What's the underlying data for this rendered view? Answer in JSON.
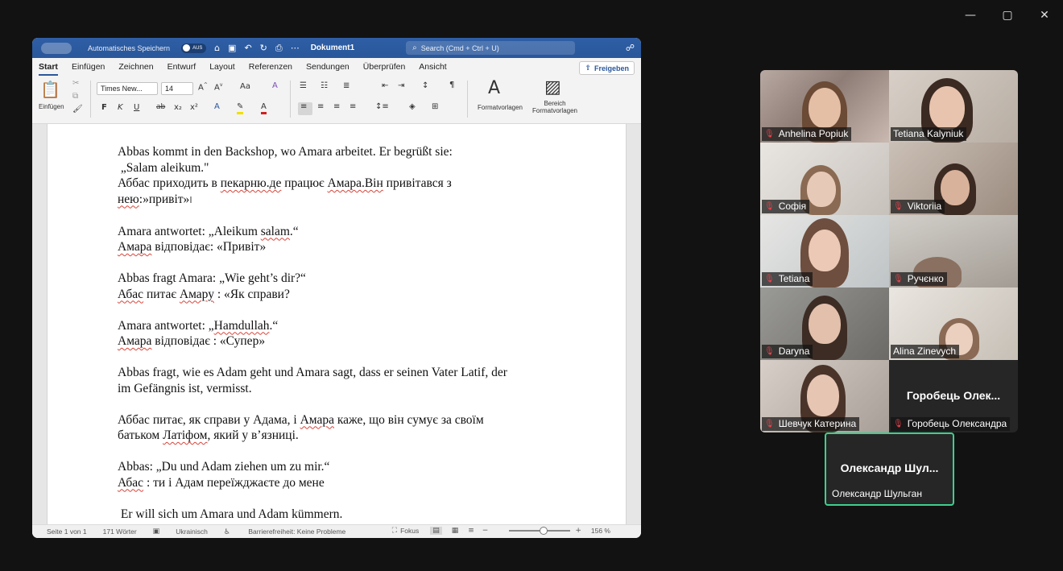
{
  "window_controls": [
    "—",
    "▢",
    "✕"
  ],
  "word": {
    "autosave_label": "Automatisches Speichern",
    "autosave_state": "AUS",
    "doc_name": "Dokument1",
    "search_placeholder": "Search (Cmd + Ctrl + U)",
    "tabs": [
      "Start",
      "Einfügen",
      "Zeichnen",
      "Entwurf",
      "Layout",
      "Referenzen",
      "Sendungen",
      "Überprüfen",
      "Ansicht"
    ],
    "share_label": "Freigeben",
    "ribbon": {
      "paste_label": "Einfügen",
      "font_name": "Times New...",
      "font_size": "14",
      "styles_label": "Formatvorlagen",
      "styles_pane_label_1": "Bereich",
      "styles_pane_label_2": "Formatvorlagen",
      "bold": "F",
      "italic": "K",
      "underline": "U",
      "strike": "ab",
      "change_case": "Aa"
    },
    "paragraphs": [
      [
        {
          "t": "Abbas kommt in den Backshop, wo Amara arbeitet. Er begrüßt sie:"
        }
      ],
      [
        {
          "t": " „Salam aleikum.\""
        }
      ],
      [
        {
          "t": "Аббас приходить в "
        },
        {
          "t": "пекарню.де",
          "sq": true
        },
        {
          "t": " працює "
        },
        {
          "t": "Амара.Він",
          "sq": true
        },
        {
          "t": " привітався з"
        }
      ],
      [
        {
          "t": "нею",
          "sq": true
        },
        {
          "t": ":»привіт»"
        },
        {
          "t": "I",
          "cursor": true
        }
      ],
      [],
      [
        {
          "t": "Amara antwortet: „Aleikum "
        },
        {
          "t": "salam",
          "sq": true
        },
        {
          "t": ".“"
        }
      ],
      [
        {
          "t": "Амара",
          "sq": true
        },
        {
          "t": " відповідає: «Привіт»"
        }
      ],
      [],
      [
        {
          "t": "Abbas fragt Amara: „Wie geht’s dir?“"
        }
      ],
      [
        {
          "t": "Абас",
          "sq": true
        },
        {
          "t": " питає "
        },
        {
          "t": "Амару",
          "sq": true
        },
        {
          "t": " : «Як справи?"
        }
      ],
      [],
      [
        {
          "t": "Amara antwortet: „"
        },
        {
          "t": "Hamdullah",
          "sq": true
        },
        {
          "t": ".“"
        }
      ],
      [
        {
          "t": "Амара",
          "sq": true
        },
        {
          "t": " відповідає : «Супер»"
        }
      ],
      [],
      [
        {
          "t": "Abbas fragt, wie es Adam geht und Amara sagt, dass er seinen Vater Latif, der"
        }
      ],
      [
        {
          "t": "im Gefängnis ist, vermisst."
        }
      ],
      [],
      [
        {
          "t": "Аббас питає, як справи у Адама, і "
        },
        {
          "t": "Амара",
          "sq": true
        },
        {
          "t": " каже, що він сумує за своїм"
        }
      ],
      [
        {
          "t": "батьком "
        },
        {
          "t": "Латіфом",
          "sq": true
        },
        {
          "t": ", який у в’язниці."
        }
      ],
      [],
      [
        {
          "t": "Abbas: „Du und Adam ziehen um zu mir.“"
        }
      ],
      [
        {
          "t": "Абас",
          "sq": true
        },
        {
          "t": " : ти і Адам переїжджаєте до мене"
        }
      ],
      [],
      [
        {
          "t": " Er will sich um Amara und Adam kümmern."
        }
      ]
    ],
    "status": {
      "page": "Seite 1 von 1",
      "words": "171 Wörter",
      "language": "Ukrainisch",
      "accessibility": "Barrierefreiheit: Keine Probleme",
      "focus": "Fokus",
      "zoom": "156 %",
      "zoom_fraction": 0.56
    }
  },
  "participants": [
    {
      "name": "Anhelina Popiuk",
      "muted": true
    },
    {
      "name": "Tetiana Kalyniuk",
      "muted": false
    },
    {
      "name": "Софія",
      "muted": true
    },
    {
      "name": "Viktoriia",
      "muted": true
    },
    {
      "name": "Tetiana",
      "muted": true
    },
    {
      "name": "Ручєнко",
      "muted": true
    },
    {
      "name": "Daryna",
      "muted": true
    },
    {
      "name": "Alina Zinevych",
      "muted": false
    },
    {
      "name": "Шевчук Катерина",
      "muted": true
    },
    {
      "name": "Горобець Олександра",
      "muted": true,
      "big": "Горобець Олек..."
    }
  ],
  "active_speaker": {
    "name": "Олександр Шульган",
    "big": "Олександр Шул..."
  }
}
